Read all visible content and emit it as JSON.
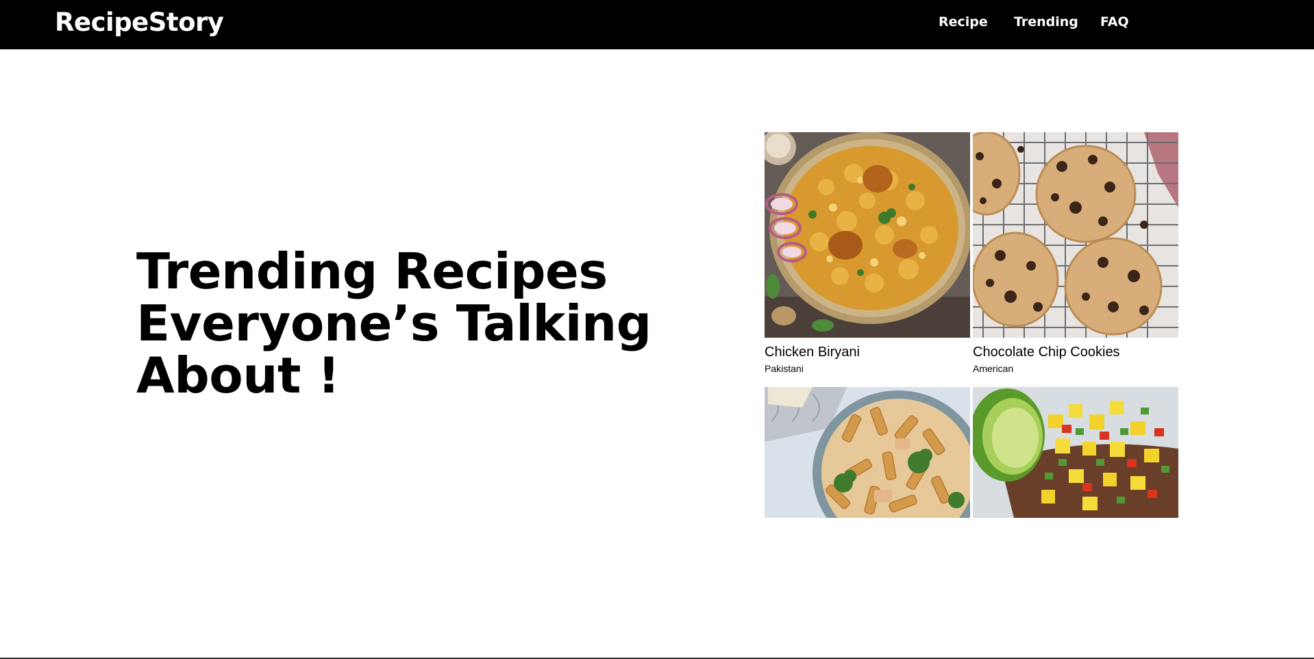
{
  "header": {
    "brand": "RecipeStory",
    "nav": [
      "Recipe",
      "Trending",
      "FAQ"
    ]
  },
  "hero": {
    "title_lines": [
      "Trending Recipes",
      "Everyone’s Talking",
      "About !"
    ]
  },
  "recipes": [
    {
      "name": "Chicken Biryani",
      "origin": "Pakistani",
      "image": "chicken-biryani-photo"
    },
    {
      "name": "Chocolate Chip Cookies",
      "origin": "American",
      "image": "chocolate-chip-cookies-photo"
    },
    {
      "image": "creamy-penne-pasta-photo"
    },
    {
      "image": "mango-salsa-photo"
    }
  ],
  "colors": {
    "navbar_bg": "#000000",
    "navbar_text": "#ffffff",
    "page_bg": "#ffffff",
    "text": "#000000"
  }
}
